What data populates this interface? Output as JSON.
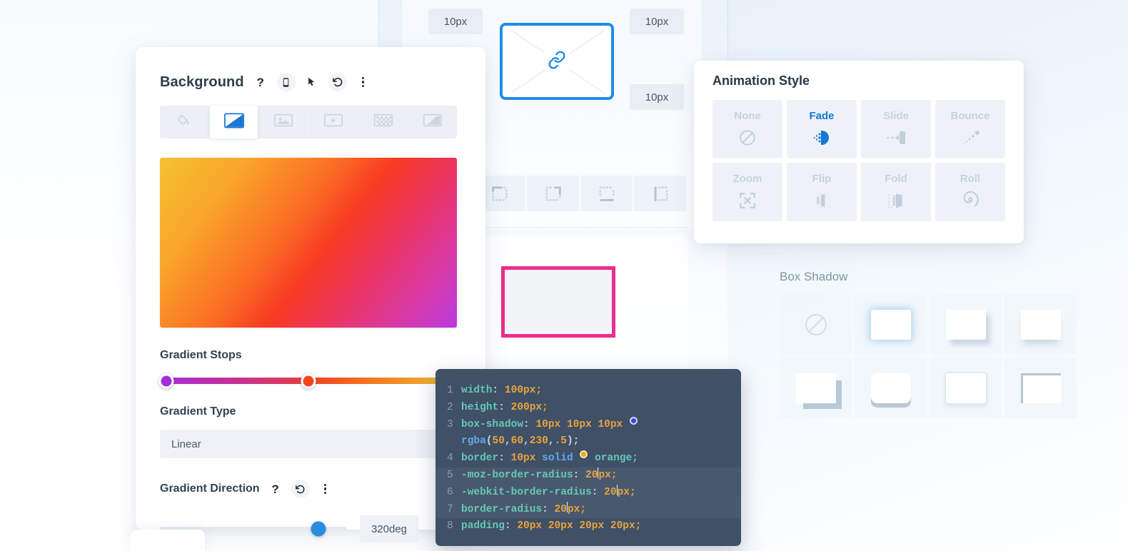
{
  "background_panel": {
    "title": "Background",
    "header_icons": [
      "help-icon",
      "mobile-icon",
      "cursor-icon",
      "reset-icon",
      "kebab-menu-icon"
    ],
    "tabs": [
      {
        "name": "color",
        "icon": "paint-bucket-icon",
        "active": false
      },
      {
        "name": "gradient",
        "icon": "gradient-icon",
        "active": true
      },
      {
        "name": "image",
        "icon": "image-icon",
        "active": false
      },
      {
        "name": "video",
        "icon": "video-icon",
        "active": false
      },
      {
        "name": "pattern",
        "icon": "pattern-icon",
        "active": false
      },
      {
        "name": "mask",
        "icon": "mask-icon",
        "active": false
      }
    ],
    "gradient_stops_label": "Gradient Stops",
    "gradient_type_label": "Gradient Type",
    "gradient_type_value": "Linear",
    "gradient_direction_label": "Gradient Direction",
    "gradient_direction_value": "320deg",
    "stops": [
      {
        "color": "#a12ed6",
        "position": "0%"
      },
      {
        "color": "#f4451b",
        "position": "50%"
      }
    ],
    "preview_colors": [
      "#f5c231",
      "#fb6d24",
      "#f73b23",
      "#d839a8",
      "#b83be0"
    ]
  },
  "artboard": {
    "spacing_chips": [
      "10px",
      "10px",
      "10px"
    ],
    "image_placeholder_icon": "link-icon",
    "image_placeholder_border_color": "#1f8ceb",
    "selected_box_border_color": "#ec2d8f",
    "corner_icons": [
      "corner-top-left-icon",
      "corner-top-right-icon",
      "corner-bottom-icon",
      "corner-left-icon"
    ]
  },
  "animation_panel": {
    "title": "Animation Style",
    "options": [
      {
        "label": "None",
        "icon": "no-animation-icon",
        "selected": false
      },
      {
        "label": "Fade",
        "icon": "fade-icon",
        "selected": true
      },
      {
        "label": "Slide",
        "icon": "slide-icon",
        "selected": false
      },
      {
        "label": "Bounce",
        "icon": "bounce-icon",
        "selected": false
      },
      {
        "label": "Zoom",
        "icon": "zoom-icon",
        "selected": false
      },
      {
        "label": "Flip",
        "icon": "flip-icon",
        "selected": false
      },
      {
        "label": "Fold",
        "icon": "fold-icon",
        "selected": false
      },
      {
        "label": "Roll",
        "icon": "roll-icon",
        "selected": false
      }
    ],
    "accent_color": "#1478d4"
  },
  "box_shadow_panel": {
    "title": "Box Shadow",
    "options": [
      {
        "name": "none",
        "icon": "no-shadow-icon",
        "selected": false
      },
      {
        "name": "glow",
        "icon": "shadow-glow-icon",
        "selected": true
      },
      {
        "name": "offset",
        "icon": "shadow-offset-icon",
        "selected": false
      },
      {
        "name": "bottom",
        "icon": "shadow-bottom-icon",
        "selected": false
      },
      {
        "name": "hard-offset",
        "icon": "shadow-hard-icon",
        "selected": false
      },
      {
        "name": "underline",
        "icon": "shadow-underline-icon",
        "selected": false
      },
      {
        "name": "outline",
        "icon": "shadow-outline-icon",
        "selected": false
      },
      {
        "name": "corner",
        "icon": "shadow-corner-icon",
        "selected": false
      }
    ]
  },
  "code_editor": {
    "lines": [
      {
        "number": "1",
        "highlighted": false
      },
      {
        "number": "2",
        "highlighted": false
      },
      {
        "number": "3",
        "highlighted": false
      },
      {
        "number": "",
        "highlighted": false
      },
      {
        "number": "4",
        "highlighted": false
      },
      {
        "number": "5",
        "highlighted": true
      },
      {
        "number": "6",
        "highlighted": true
      },
      {
        "number": "7",
        "highlighted": true
      },
      {
        "number": "8",
        "highlighted": false
      }
    ],
    "l1_num": "1",
    "l1_prop": "width",
    "l1_val": "100px",
    "l2_num": "2",
    "l2_prop": "height",
    "l2_val": "200px",
    "l3_num": "3",
    "l3_prop": "box-shadow",
    "l3_v1": "10px",
    "l3_v2": "10px",
    "l3_v3": "10px",
    "l3b_fn": "rgba",
    "l3b_a": "50",
    "l3b_b": "60",
    "l3b_c": "230",
    "l3b_d": ".5",
    "l4_num": "4",
    "l4_prop": "border",
    "l4_v1": "10px",
    "l4_kw": "solid",
    "l4_color": "orange",
    "l5_num": "5",
    "l5_prop": "-moz-border-radius",
    "l5_val_a": "20",
    "l5_val_b": "px",
    "l6_num": "6",
    "l6_prop": "-webkit-border-radius",
    "l6_val_a": "20",
    "l6_val_b": "px",
    "l7_num": "7",
    "l7_prop": "border-radius",
    "l7_val_a": "20",
    "l7_val_b": "px",
    "l8_num": "8",
    "l8_prop": "padding",
    "l8_v1": "20px",
    "l8_v2": "20px",
    "l8_v3": "20px",
    "l8_v4": "20px",
    "colors": {
      "prop": "#66c7b4",
      "value": "#e8a33d",
      "func": "#5fa8e8",
      "bg": "#3f5067"
    }
  }
}
